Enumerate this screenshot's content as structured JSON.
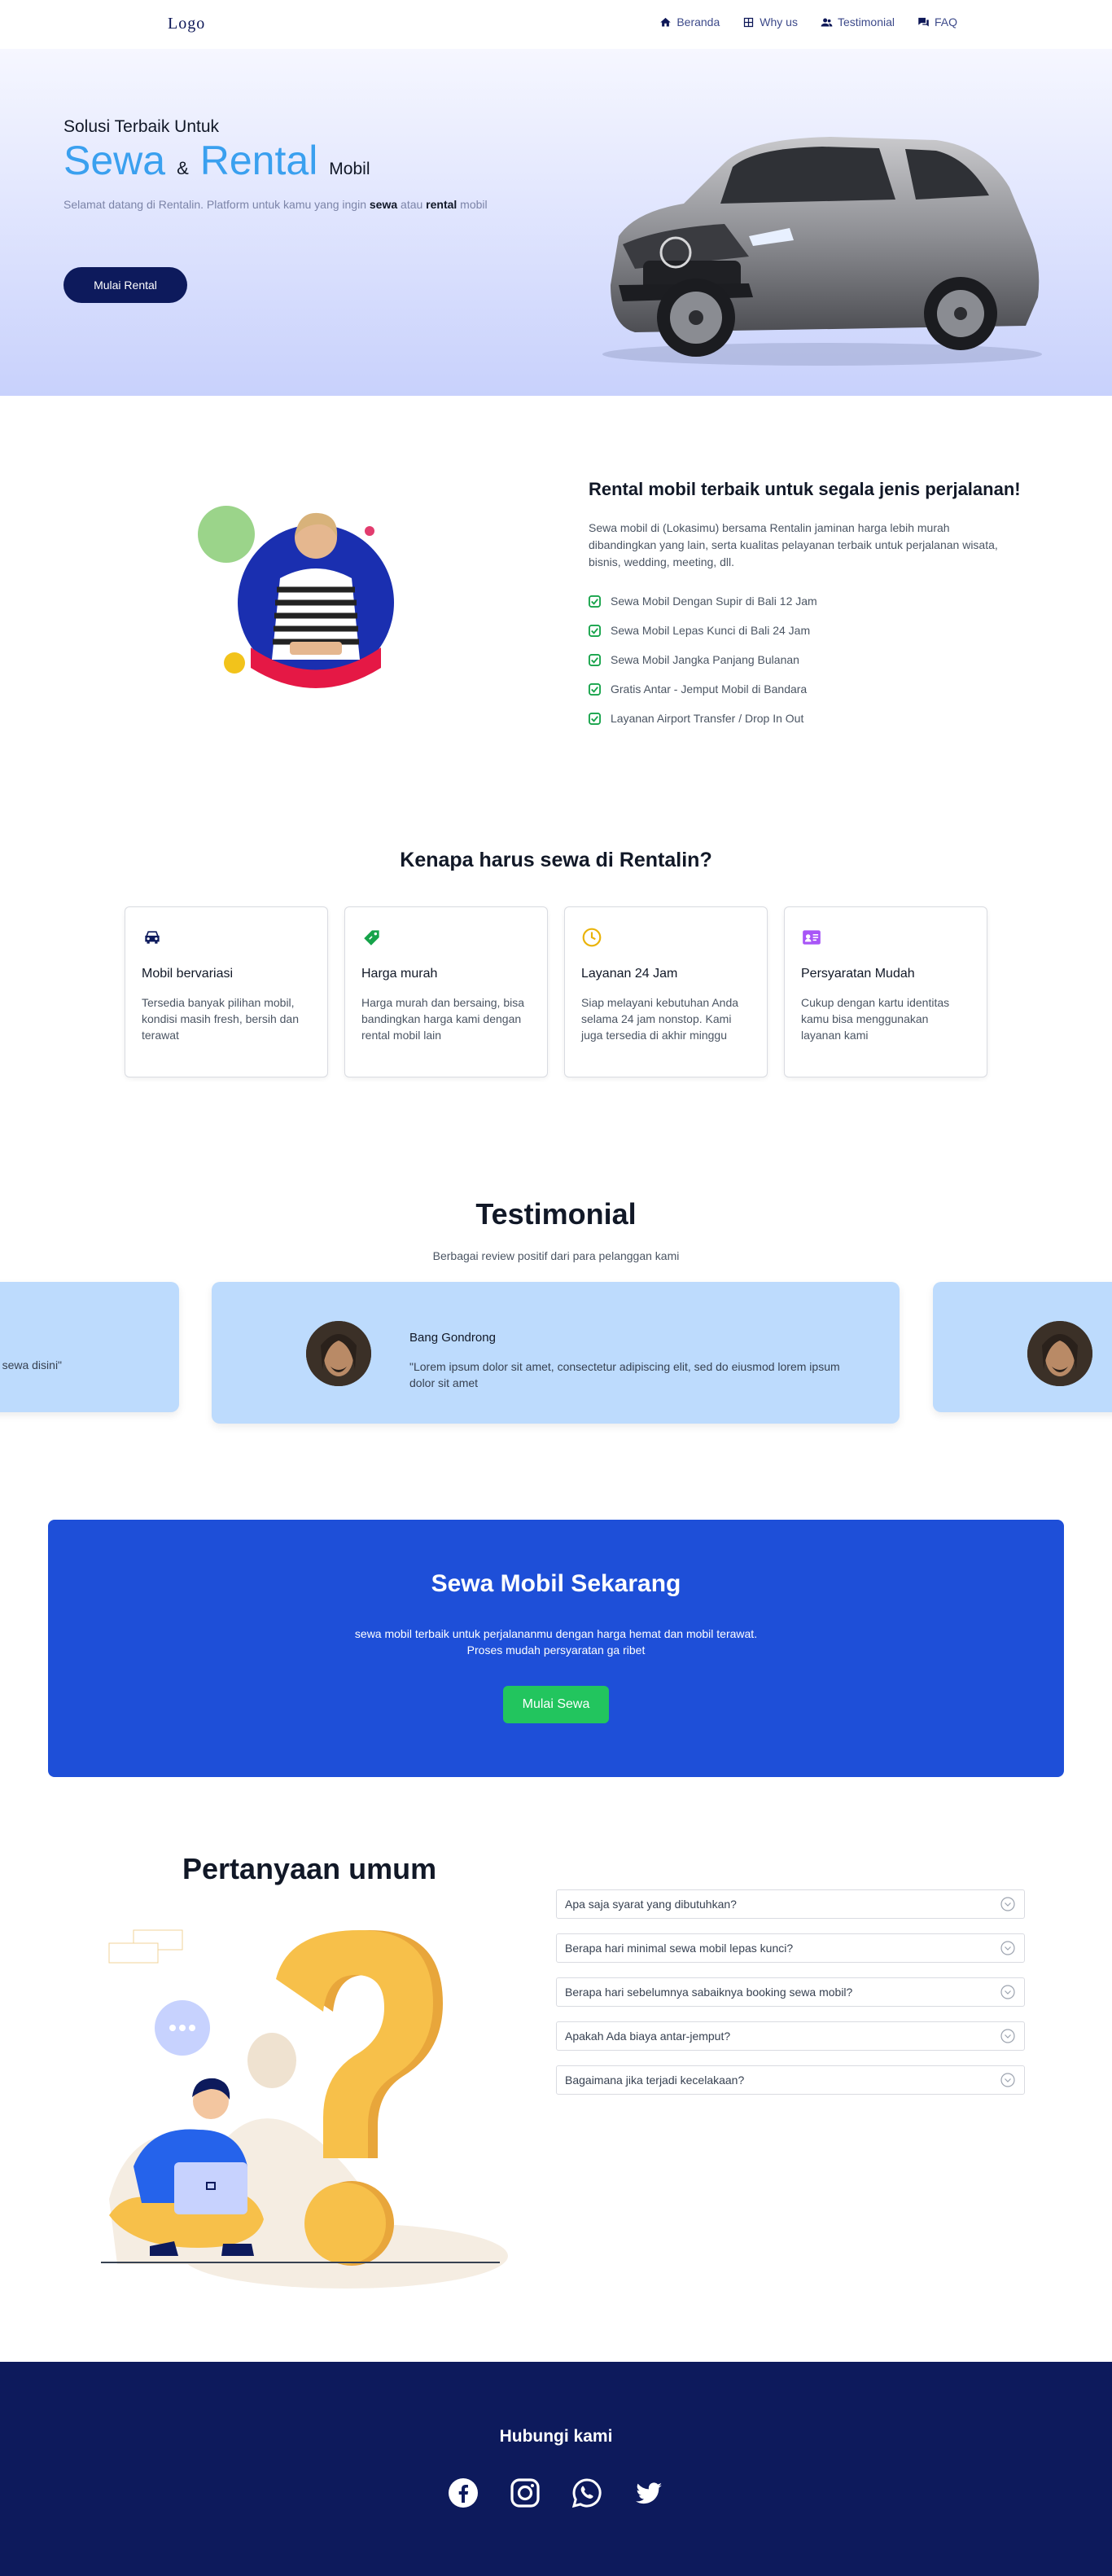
{
  "nav": {
    "logo": "Logo",
    "links": [
      {
        "label": "Beranda",
        "icon": "home-icon"
      },
      {
        "label": "Why us",
        "icon": "grid-icon"
      },
      {
        "label": "Testimonial",
        "icon": "users-icon"
      },
      {
        "label": "FAQ",
        "icon": "chat-icon"
      }
    ]
  },
  "hero": {
    "subtitle": "Solusi Terbaik Untuk",
    "word1": "Sewa",
    "amp": "&",
    "word2": "Rental",
    "word3": "Mobil",
    "desc_prefix": "Selamat datang di Rentalin. Platform untuk kamu yang ingin ",
    "desc_bold1": "sewa",
    "desc_mid": " atau ",
    "desc_bold2": "rental",
    "desc_suffix": " mobil",
    "button": "Mulai Rental"
  },
  "about": {
    "title": "Rental mobil terbaik untuk segala jenis perjalanan!",
    "desc": "Sewa mobil di (Lokasimu) bersama Rentalin jaminan harga lebih murah dibandingkan yang lain, serta kualitas pelayanan terbaik untuk perjalanan wisata, bisnis, wedding, meeting, dll.",
    "items": [
      "Sewa Mobil Dengan Supir di Bali 12 Jam",
      "Sewa Mobil Lepas Kunci di Bali 24 Jam",
      "Sewa Mobil Jangka Panjang Bulanan",
      "Gratis Antar - Jemput Mobil di Bandara",
      "Layanan Airport Transfer / Drop In Out"
    ]
  },
  "why": {
    "title": "Kenapa harus sewa di Rentalin?",
    "cards": [
      {
        "title": "Mobil bervariasi",
        "desc": "Tersedia banyak pilihan mobil, kondisi masih fresh, bersih dan terawat",
        "icon": "car-icon"
      },
      {
        "title": "Harga murah",
        "desc": "Harga murah dan bersaing, bisa bandingkan harga kami dengan rental mobil lain",
        "icon": "price-tag-icon"
      },
      {
        "title": "Layanan 24 Jam",
        "desc": "Siap melayani kebutuhan Anda selama 24 jam nonstop. Kami juga tersedia di akhir minggu",
        "icon": "clock-icon"
      },
      {
        "title": "Persyaratan Mudah",
        "desc": "Cukup dengan kartu identitas kamu bisa menggunakan layanan kami",
        "icon": "id-card-icon"
      }
    ]
  },
  "testimonial": {
    "title": "Testimonial",
    "subtitle": "Berbagai review positif dari para pelanggan kami",
    "left_quote": "leh sewa disini\"",
    "main": {
      "name": "Bang Gondrong",
      "quote": "\"Lorem ipsum dolor sit amet, consectetur adipiscing elit, sed do eiusmod lorem ipsum dolor sit amet"
    }
  },
  "cta": {
    "title": "Sewa Mobil Sekarang",
    "desc": "sewa mobil terbaik untuk perjalananmu dengan harga hemat dan mobil terawat. Proses mudah persyaratan ga ribet",
    "button": "Mulai Sewa"
  },
  "faq": {
    "title": "Pertanyaan umum",
    "items": [
      "Apa saja syarat yang dibutuhkan?",
      "Berapa hari minimal sewa mobil lepas kunci?",
      "Berapa hari sebelumnya sabaiknya booking sewa mobil?",
      "Apakah Ada biaya antar-jemput?",
      "Bagaimana jika terjadi kecelakaan?"
    ]
  },
  "footer": {
    "title": "Hubungi kami",
    "socials": [
      "facebook-icon",
      "instagram-icon",
      "whatsapp-icon",
      "twitter-icon"
    ]
  },
  "colors": {
    "navy": "#0d1a5c",
    "accent_blue": "#3aa0ef",
    "cta_blue": "#1e4fd8",
    "green": "#22c55e",
    "testimonial_card": "#bddbfd"
  }
}
